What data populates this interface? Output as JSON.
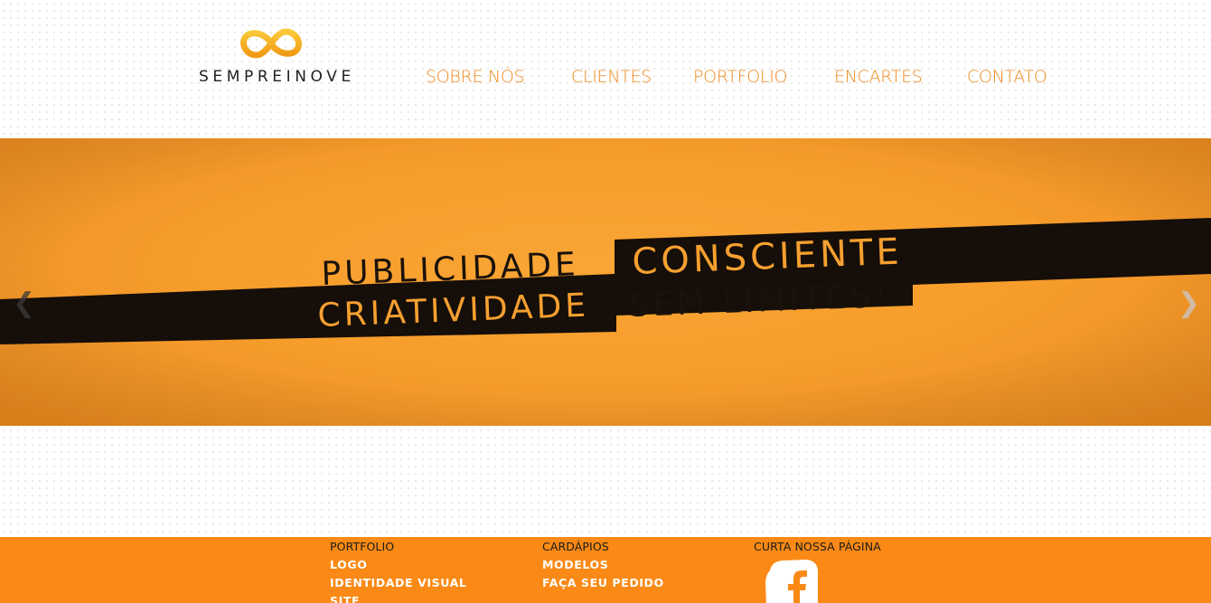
{
  "colors": {
    "accent": "#ef8a1e",
    "banner_orange": "#f79e2c",
    "footer_orange": "#fa8a15",
    "dark_stripe": "#160e08"
  },
  "logo": {
    "text": "SEMPREINOVE",
    "icon": "infinity-icon"
  },
  "nav": {
    "items": [
      {
        "label": "SOBRE NÓS"
      },
      {
        "label": "CLIENTES"
      },
      {
        "label": "PORTFOLIO"
      },
      {
        "label": "ENCARTES"
      },
      {
        "label": "CONTATO"
      }
    ]
  },
  "slider": {
    "line1_word1": "PUBLICIDADE",
    "line1_word2": "CONSCIENTE",
    "line2_word1": "CRIATIVIDADE",
    "line2_word2": "SEM LIMITES!",
    "prev_icon": "chevron-left-icon",
    "next_icon": "chevron-right-icon",
    "prev_glyph": "❮",
    "next_glyph": "❯"
  },
  "footer": {
    "columns": [
      {
        "heading": "PORTFOLIO",
        "links": [
          "LOGO",
          "IDENTIDADE VISUAL",
          "SITE"
        ]
      },
      {
        "heading": "CARDÁPIOS",
        "links": [
          "MODELOS",
          "FAÇA SEU PEDIDO"
        ]
      },
      {
        "heading": "CURTA NOSSA PÁGINA",
        "icon": "facebook-icon"
      }
    ]
  }
}
